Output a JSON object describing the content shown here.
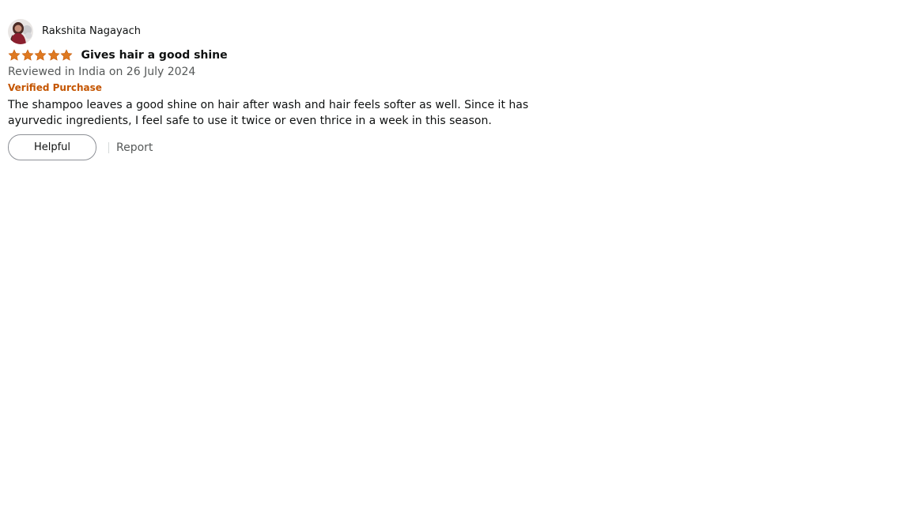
{
  "review": {
    "reviewer_name": "Rakshita Nagayach",
    "avatar_icon": "profile-photo",
    "rating": {
      "value": 5,
      "max": 5,
      "icon": "star-icon",
      "color": "#de7921"
    },
    "title": "Gives hair a good shine",
    "date_text": "Reviewed in India on 26 July 2024",
    "verified_label": "Verified Purchase",
    "verified_color": "#c45500",
    "body": "The shampoo leaves a good shine on hair after wash and hair feels softer as well. Since it has ayurvedic ingredients, I feel safe to use it twice or even thrice in a week in this season.",
    "actions": {
      "helpful_label": "Helpful",
      "report_label": "Report"
    }
  }
}
